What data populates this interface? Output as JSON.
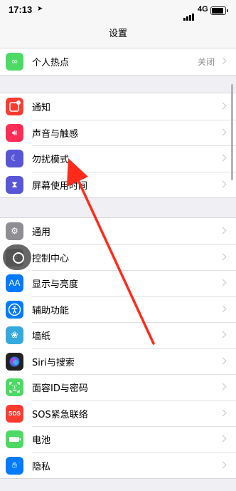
{
  "status_bar": {
    "time": "17:13",
    "location_icon": "location-arrow-icon",
    "network": "4G"
  },
  "nav": {
    "title": "设置"
  },
  "groups": [
    {
      "items": [
        {
          "label": "个人热点",
          "value": "关闭",
          "icon": "hotspot-icon",
          "color": "#4cd964"
        }
      ]
    },
    {
      "items": [
        {
          "label": "通知",
          "icon": "notification-icon",
          "color": "#ff3b30"
        },
        {
          "label": "声音与触感",
          "icon": "speaker-icon",
          "color": "#ff2d55"
        },
        {
          "label": "勿扰模式",
          "icon": "moon-icon",
          "color": "#5856d6"
        },
        {
          "label": "屏幕使用时间",
          "icon": "hourglass-icon",
          "color": "#5856d6"
        }
      ]
    },
    {
      "items": [
        {
          "label": "通用",
          "icon": "gear-icon",
          "color": "#8e8e93"
        },
        {
          "label": "控制中心",
          "icon": "toggle-icon",
          "color": "#8e8e93"
        },
        {
          "label": "显示与亮度",
          "icon": "text-size-icon",
          "color": "#007aff"
        },
        {
          "label": "辅助功能",
          "icon": "accessibility-icon",
          "color": "#007aff"
        },
        {
          "label": "墙纸",
          "icon": "flower-icon",
          "color": "#34aadc"
        },
        {
          "label": "Siri与搜索",
          "icon": "siri-icon",
          "color": "#222222"
        },
        {
          "label": "面容ID与密码",
          "icon": "face-id-icon",
          "color": "#4cd964"
        },
        {
          "label": "SOS紧急联络",
          "icon": "sos-icon",
          "color": "#ff3b30",
          "icon_text": "SOS"
        },
        {
          "label": "电池",
          "icon": "battery-icon",
          "color": "#4cd964"
        },
        {
          "label": "隐私",
          "icon": "hand-icon",
          "color": "#007aff"
        }
      ]
    }
  ],
  "overlay": {
    "assistive_touch": "assistive-touch-icon",
    "annotation": "red-arrow-icon",
    "annotation_color": "#ff2a1a"
  }
}
